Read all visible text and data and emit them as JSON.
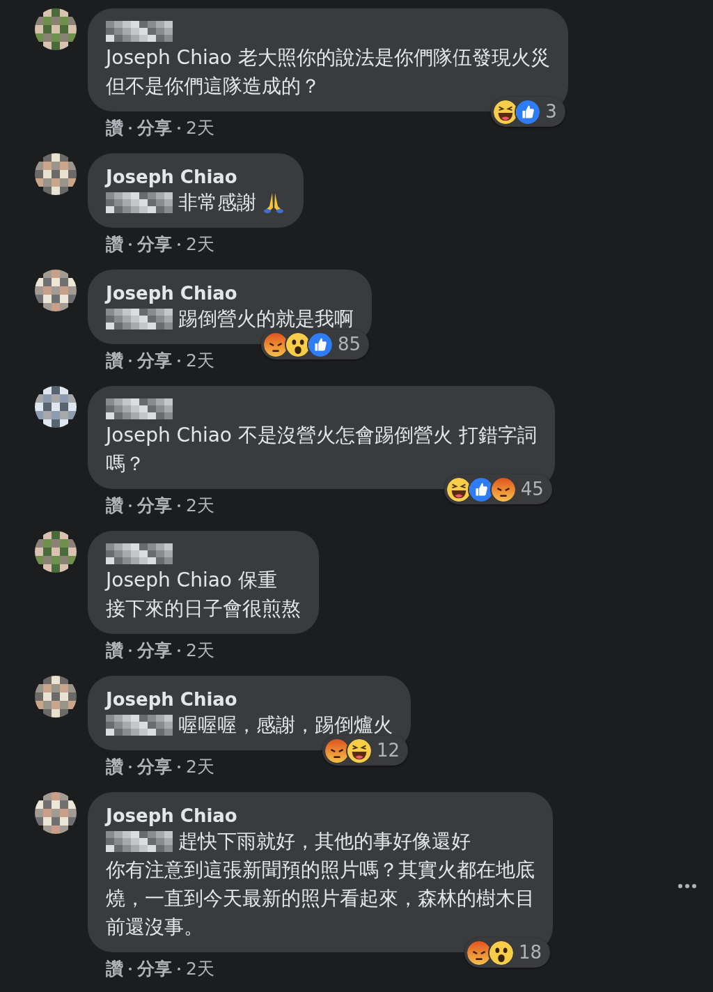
{
  "comments": [
    {
      "mention_hidden": false,
      "lines": [
        "Joseph Chiao 老大照你的說法是你們隊伍發現火災",
        "但不是你們這隊造成的？"
      ],
      "reactions": {
        "icons": [
          {
            "kind": "haha"
          },
          {
            "kind": "like"
          }
        ],
        "count": "3"
      },
      "actions": [
        "讚",
        "分享",
        "2天"
      ]
    },
    {
      "author": "Joseph Chiao",
      "mention_hidden": true,
      "lines": [
        "非常感謝"
      ],
      "emoji": {
        "kind": "pray"
      },
      "actions": [
        "讚",
        "分享",
        "2天"
      ]
    },
    {
      "author": "Joseph Chiao",
      "mention_hidden": true,
      "lines": [
        "踢倒營火的就是我啊"
      ],
      "reactions": {
        "icons": [
          {
            "kind": "angry"
          },
          {
            "kind": "wow"
          },
          {
            "kind": "like"
          }
        ],
        "count": "85"
      },
      "actions": [
        "讚",
        "分享",
        "2天"
      ]
    },
    {
      "mention_hidden": false,
      "lines": [
        "Joseph Chiao 不是沒營火怎會踢倒營火 打錯字詞",
        "嗎？"
      ],
      "reactions": {
        "icons": [
          {
            "kind": "haha"
          },
          {
            "kind": "like"
          },
          {
            "kind": "angry"
          }
        ],
        "count": "45"
      },
      "actions": [
        "讚",
        "分享",
        "2天"
      ]
    },
    {
      "mention_hidden": false,
      "lines": [
        "Joseph Chiao 保重",
        "接下來的日子會很煎熬"
      ],
      "actions": [
        "讚",
        "分享",
        "2天"
      ]
    },
    {
      "author": "Joseph Chiao",
      "mention_hidden": true,
      "lines": [
        "喔喔喔，感謝，踢倒爐火"
      ],
      "reactions": {
        "icons": [
          {
            "kind": "angry"
          },
          {
            "kind": "haha"
          }
        ],
        "count": "12"
      },
      "actions": [
        "讚",
        "分享",
        "2天"
      ]
    },
    {
      "author": "Joseph Chiao",
      "mention_hidden": true,
      "lines": [
        "趕快下雨就好，其他的事好像還好",
        "你有注意到這張新聞預的照片嗎？其實火都在地底",
        "燒，一直到今天最新的照片看起來，森林的樹木目",
        "前還沒事。"
      ],
      "reactions": {
        "icons": [
          {
            "kind": "angry"
          },
          {
            "kind": "wow"
          }
        ],
        "count": "18"
      },
      "actions": [
        "讚",
        "分享",
        "2天"
      ],
      "more_button": true
    }
  ]
}
